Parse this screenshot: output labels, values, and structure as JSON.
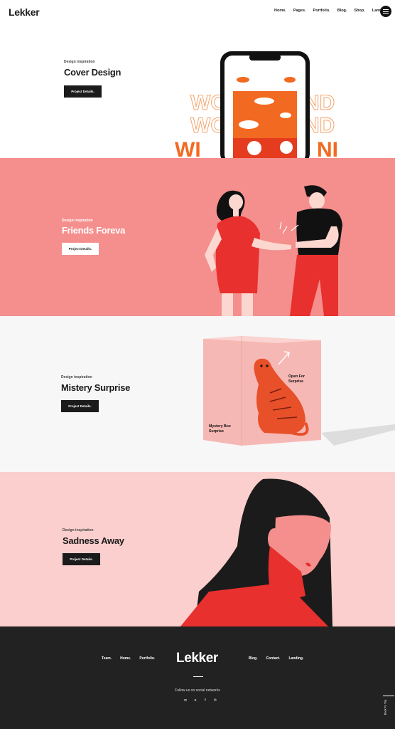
{
  "header": {
    "logo": "Lekker",
    "nav": [
      "Home.",
      "Pages.",
      "Portfolio.",
      "Blog.",
      "Shop.",
      "Landing."
    ]
  },
  "projects": [
    {
      "eyebrow": "Design inspiration",
      "title": "Cover Design",
      "button": "Project Details."
    },
    {
      "eyebrow": "Design inspiration",
      "title": "Friends Foreva",
      "button": "Project Details."
    },
    {
      "eyebrow": "Design inspiration",
      "title": "Mistery Surprise",
      "button": "Project Details."
    },
    {
      "eyebrow": "Design inspiration",
      "title": "Sadness Away",
      "button": "Project Details."
    }
  ],
  "box": {
    "label_front": "Open For\nSurprise",
    "label_side": "Mystery Box\nSurprise"
  },
  "cover_text": [
    "WO",
    "ND"
  ],
  "footer": {
    "left_nav": [
      "Team.",
      "Home.",
      "Portfolio."
    ],
    "logo": "Lekker",
    "right_nav": [
      "Blog.",
      "Contact.",
      "Landing."
    ],
    "follow": "Follow us on social networks",
    "socials": [
      "instagram-icon",
      "twitter-icon",
      "facebook-icon",
      "pinterest-icon"
    ],
    "back_to_top": "Back To Top"
  },
  "colors": {
    "dark": "#1b1b1b",
    "coral": "#f48f8d",
    "pink": "#fbcfcd",
    "red": "#e8302e",
    "orange": "#f26a21"
  }
}
